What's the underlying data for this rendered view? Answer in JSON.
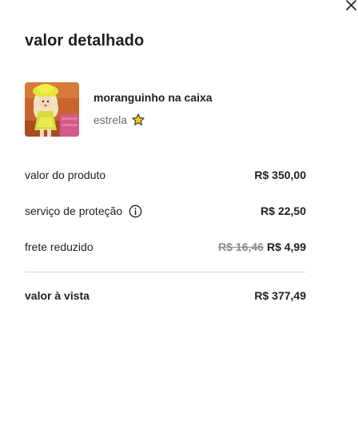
{
  "panel": {
    "title": "valor detalhado",
    "close_icon": "close-icon"
  },
  "product": {
    "name": "moranguinho na caixa",
    "brand": "estrela",
    "brand_icon": "star-icon",
    "thumbnail": "doll-thumbnail"
  },
  "breakdown": {
    "product_value": {
      "label": "valor do produto",
      "value": "R$ 350,00"
    },
    "protection": {
      "label": "serviço de proteção",
      "value": "R$ 22,50",
      "icon": "info-icon"
    },
    "shipping": {
      "label": "frete reduzido",
      "old_value": "R$ 16,46",
      "value": "R$ 4,99"
    }
  },
  "total": {
    "label": "valor à vista",
    "value": "R$ 377,49"
  },
  "colors": {
    "text": "#1f1f1f",
    "muted": "#6b6b6b",
    "divider": "#d9d9d9",
    "star": "#f5c518"
  }
}
